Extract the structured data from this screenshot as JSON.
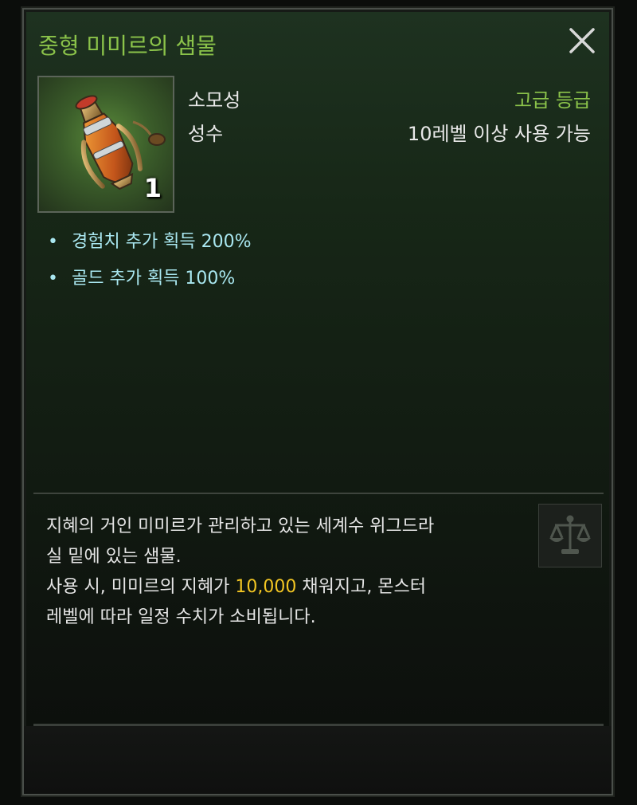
{
  "item": {
    "name": "중형 미미르의 샘물",
    "category": "소모성",
    "subcategory": "성수",
    "grade": "고급 등급",
    "requirement": "10레벨 이상 사용 가능",
    "count": "1",
    "icon": "potion-flask-icon"
  },
  "effects": [
    {
      "bullet": "•",
      "text": "경험치 추가 획득 200%"
    },
    {
      "bullet": "•",
      "text": "골드 추가 획득 100%"
    }
  ],
  "description": {
    "line1": "지혜의 거인 미미르가 관리하고 있는 세계수 위그드라",
    "line2": "실 밑에 있는 샘물.",
    "line3_prefix": "사용 시, 미미르의 지혜가 ",
    "line3_value": "10,000",
    "line3_suffix": " 채워지고, 몬스터",
    "line4": "레벨에 따라 일정 수치가 소비됩니다."
  },
  "colors": {
    "title_green": "#8bc34a",
    "effect_cyan": "#a9e7f0",
    "highlight_gold": "#f3c623"
  },
  "icons": {
    "close": "close-icon",
    "trade": "scale-icon"
  }
}
